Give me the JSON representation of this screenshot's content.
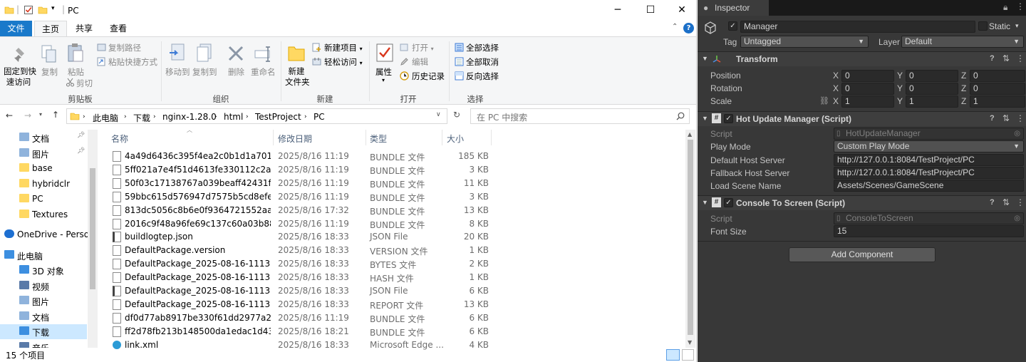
{
  "explorer": {
    "title": "PC",
    "window_controls": {
      "minimize": "─",
      "maximize": "☐",
      "close": "✕"
    },
    "tabs": [
      {
        "label": "文件",
        "style": "file"
      },
      {
        "label": "主页",
        "style": "active"
      },
      {
        "label": "共享",
        "style": ""
      },
      {
        "label": "查看",
        "style": ""
      }
    ],
    "ribbon": {
      "pin_quick": "固定到快速访问",
      "pin_quick_l1": "固定到快",
      "pin_quick_l2": "速访问",
      "copy": "复制",
      "paste": "粘贴",
      "copy_path": "复制路径",
      "paste_shortcut": "粘贴快捷方式",
      "cut": "剪切",
      "clipboard_group": "剪贴板",
      "move_to": "移动到",
      "copy_to": "复制到",
      "delete": "删除",
      "rename": "重命名",
      "organize_group": "组织",
      "new_folder_l1": "新建",
      "new_folder_l2": "文件夹",
      "new_item": "新建项目",
      "easy_access": "轻松访问",
      "new_group": "新建",
      "properties": "属性",
      "open": "打开",
      "edit": "编辑",
      "history": "历史记录",
      "open_group": "打开",
      "select_all": "全部选择",
      "select_none": "全部取消",
      "invert_select": "反向选择",
      "select_group": "选择"
    },
    "breadcrumb": [
      "此电脑",
      "下载",
      "nginx-1.28.0",
      "html",
      "TestProject",
      "PC"
    ],
    "search_placeholder": "在 PC 中搜索",
    "nav_items": [
      {
        "label": "文档",
        "icon": "document-folder-icon",
        "pinned": true
      },
      {
        "label": "图片",
        "icon": "pictures-folder-icon",
        "pinned": true
      },
      {
        "label": "base",
        "icon": "folder-icon"
      },
      {
        "label": "hybridclr",
        "icon": "folder-icon"
      },
      {
        "label": "PC",
        "icon": "folder-icon"
      },
      {
        "label": "Textures",
        "icon": "folder-icon"
      },
      {
        "label": "OneDrive - Perso",
        "icon": "onedrive-icon"
      },
      {
        "label": "此电脑",
        "icon": "computer-icon"
      },
      {
        "label": "3D 对象",
        "icon": "3d-objects-icon"
      },
      {
        "label": "视频",
        "icon": "video-icon"
      },
      {
        "label": "图片",
        "icon": "pictures-icon"
      },
      {
        "label": "文档",
        "icon": "documents-icon"
      },
      {
        "label": "下载",
        "icon": "download-icon",
        "selected": true
      },
      {
        "label": "音乐",
        "icon": "music-icon"
      }
    ],
    "columns": {
      "name": "名称",
      "date": "修改日期",
      "type": "类型",
      "size": "大小"
    },
    "files": [
      {
        "name": "4a49d6436c395f4ea2c0b1d1a701e05...",
        "date": "2025/8/16 11:19",
        "type": "BUNDLE 文件",
        "size": "185 KB",
        "icon": "file-icon"
      },
      {
        "name": "5ff021a7e4f51d4613fe330112c2a076...",
        "date": "2025/8/16 11:19",
        "type": "BUNDLE 文件",
        "size": "3 KB",
        "icon": "file-icon"
      },
      {
        "name": "50f03c17138767a039beaff42431f9a7....",
        "date": "2025/8/16 11:19",
        "type": "BUNDLE 文件",
        "size": "11 KB",
        "icon": "file-icon"
      },
      {
        "name": "59bbc615d576947d7575b5cd8efe96...",
        "date": "2025/8/16 11:19",
        "type": "BUNDLE 文件",
        "size": "3 KB",
        "icon": "file-icon"
      },
      {
        "name": "813dc5056c8b6e0f9364721552aa1fbf...",
        "date": "2025/8/16 17:32",
        "type": "BUNDLE 文件",
        "size": "13 KB",
        "icon": "file-icon"
      },
      {
        "name": "2016c9f48a96fe69c137c60a03b88db...",
        "date": "2025/8/16 11:19",
        "type": "BUNDLE 文件",
        "size": "8 KB",
        "icon": "file-icon"
      },
      {
        "name": "buildlogtep.json",
        "date": "2025/8/16 18:33",
        "type": "JSON File",
        "size": "20 KB",
        "icon": "json-file-icon"
      },
      {
        "name": "DefaultPackage.version",
        "date": "2025/8/16 18:33",
        "type": "VERSION 文件",
        "size": "1 KB",
        "icon": "file-icon"
      },
      {
        "name": "DefaultPackage_2025-08-16-1113.byt...",
        "date": "2025/8/16 18:33",
        "type": "BYTES 文件",
        "size": "2 KB",
        "icon": "file-icon"
      },
      {
        "name": "DefaultPackage_2025-08-16-1113.hash",
        "date": "2025/8/16 18:33",
        "type": "HASH 文件",
        "size": "1 KB",
        "icon": "file-icon"
      },
      {
        "name": "DefaultPackage_2025-08-16-1113.json",
        "date": "2025/8/16 18:33",
        "type": "JSON File",
        "size": "6 KB",
        "icon": "json-file-icon"
      },
      {
        "name": "DefaultPackage_2025-08-16-1113.rep...",
        "date": "2025/8/16 18:33",
        "type": "REPORT 文件",
        "size": "13 KB",
        "icon": "file-icon"
      },
      {
        "name": "df0d77ab8917be330f61dd2977a2c89...",
        "date": "2025/8/16 11:19",
        "type": "BUNDLE 文件",
        "size": "6 KB",
        "icon": "file-icon"
      },
      {
        "name": "ff2d78fb213b148500da1edac1d436a...",
        "date": "2025/8/16 18:21",
        "type": "BUNDLE 文件",
        "size": "6 KB",
        "icon": "file-icon"
      },
      {
        "name": "link.xml",
        "date": "2025/8/16 18:33",
        "type": "Microsoft Edge ...",
        "size": "4 KB",
        "icon": "edge-file-icon"
      }
    ],
    "status": "15 个项目"
  },
  "inspector": {
    "tab_label": "Inspector",
    "object_name": "Manager",
    "static_label": "Static",
    "tag_label": "Tag",
    "tag_value": "Untagged",
    "layer_label": "Layer",
    "layer_value": "Default",
    "transform": {
      "title": "Transform",
      "position_label": "Position",
      "rotation_label": "Rotation",
      "scale_label": "Scale",
      "axes": [
        "X",
        "Y",
        "Z"
      ],
      "position": [
        "0",
        "0",
        "0"
      ],
      "rotation": [
        "0",
        "0",
        "0"
      ],
      "scale": [
        "1",
        "1",
        "1"
      ]
    },
    "hot_update": {
      "title": "Hot Update Manager (Script)",
      "script_label": "Script",
      "script_value": "HotUpdateManager",
      "play_mode_label": "Play Mode",
      "play_mode_value": "Custom Play Mode",
      "default_host_label": "Default Host Server",
      "default_host_value": "http://127.0.0.1:8084/TestProject/PC",
      "fallback_host_label": "Fallback Host Server",
      "fallback_host_value": "http://127.0.0.1:8084/TestProject/PC",
      "load_scene_label": "Load Scene Name",
      "load_scene_value": "Assets/Scenes/GameScene"
    },
    "console": {
      "title": "Console To Screen (Script)",
      "script_label": "Script",
      "script_value": "ConsoleToScreen",
      "font_size_label": "Font Size",
      "font_size_value": "15"
    },
    "add_component": "Add Component",
    "colors": {
      "panel": "#383838",
      "field": "#2a2a2a",
      "header": "#3e3e3e",
      "accent": "#1979ca"
    }
  }
}
